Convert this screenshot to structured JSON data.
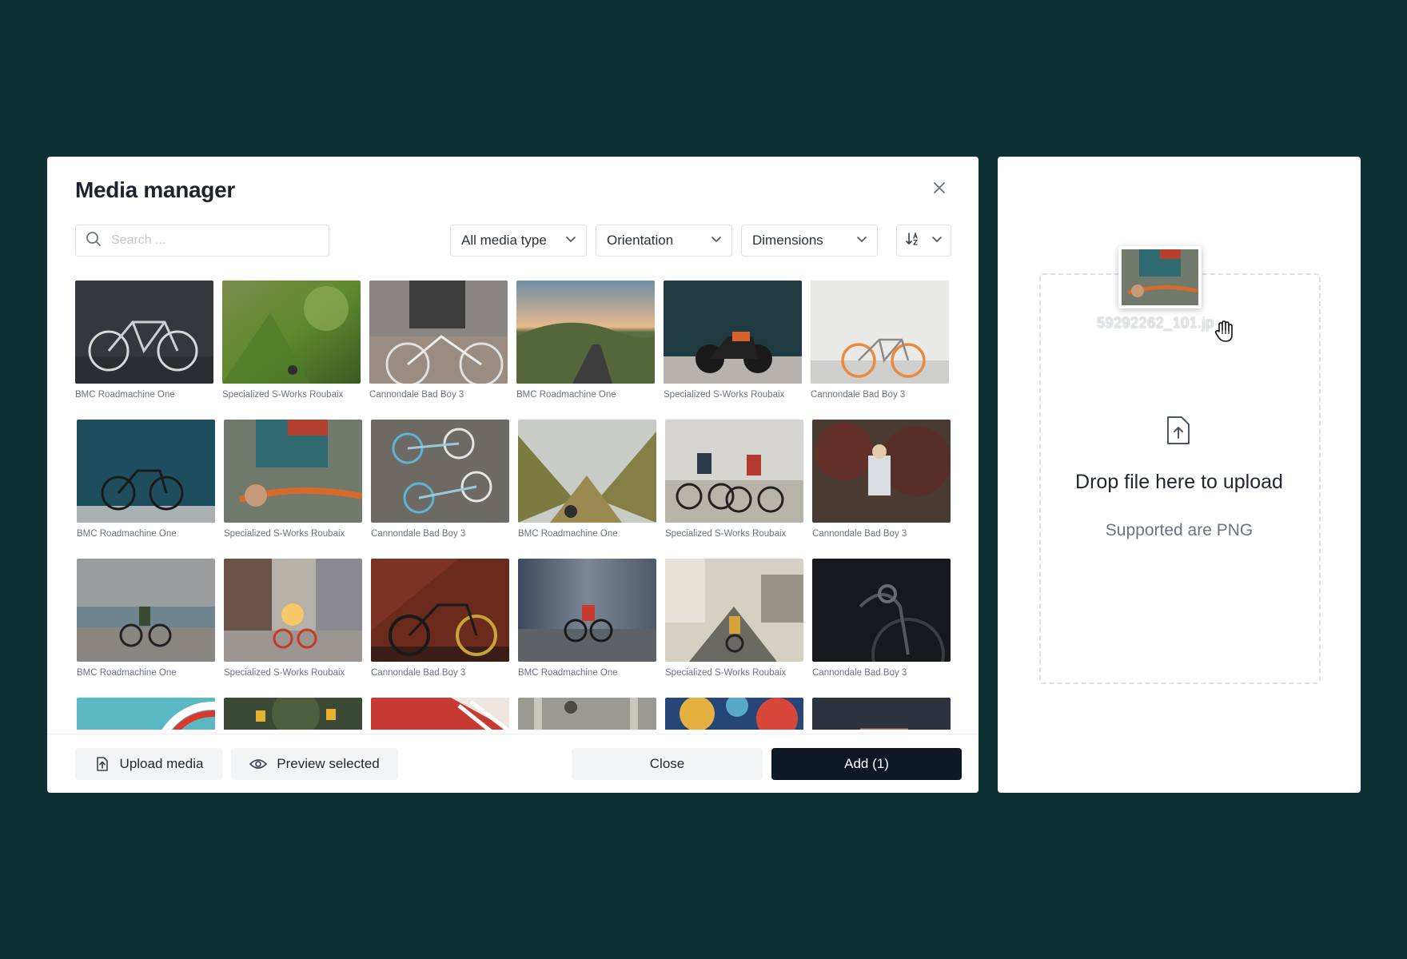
{
  "modal": {
    "title": "Media manager",
    "search_placeholder": "Search ...",
    "filters": {
      "media_type": "All media type",
      "orientation": "Orientation",
      "dimensions": "Dimensions"
    },
    "items": [
      {
        "caption": "BMC Roadmachine One"
      },
      {
        "caption": "Specialized S-Works Roubaix"
      },
      {
        "caption": "Cannondale Bad Boy 3"
      },
      {
        "caption": "BMC Roadmachine One"
      },
      {
        "caption": "Specialized S-Works Roubaix"
      },
      {
        "caption": "Cannondale Bad Boy 3"
      },
      {
        "caption": "BMC Roadmachine One"
      },
      {
        "caption": "Specialized S-Works Roubaix"
      },
      {
        "caption": "Cannondale Bad Boy 3"
      },
      {
        "caption": "BMC Roadmachine One"
      },
      {
        "caption": "Specialized S-Works Roubaix"
      },
      {
        "caption": "Cannondale Bad Boy 3"
      },
      {
        "caption": "BMC Roadmachine One"
      },
      {
        "caption": "Specialized S-Works Roubaix"
      },
      {
        "caption": "Cannondale Bad Boy 3"
      },
      {
        "caption": "BMC Roadmachine One"
      },
      {
        "caption": "Specialized S-Works Roubaix"
      },
      {
        "caption": "Cannondale Bad Boy 3"
      }
    ],
    "footer": {
      "upload_label": "Upload media",
      "preview_label": "Preview selected",
      "close_label": "Close",
      "add_label": "Add (1)"
    }
  },
  "upload_panel": {
    "drop_title": "Drop file here to upload",
    "drop_subtitle": "Supported are PNG",
    "dragged_file_name": "59292262_101.jp"
  },
  "colors": {
    "background": "#0d3133",
    "primary_button": "#0f1726"
  }
}
